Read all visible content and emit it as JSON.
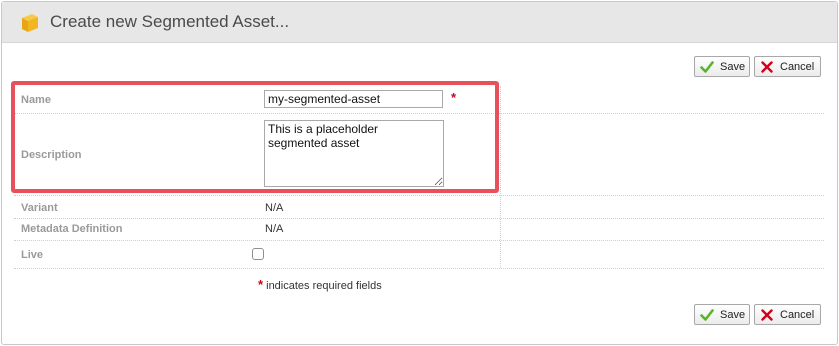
{
  "window": {
    "title": "Create new Segmented Asset...",
    "icon": "cube-icon"
  },
  "toolbar": {
    "save_label": "Save",
    "cancel_label": "Cancel"
  },
  "form": {
    "name": {
      "label": "Name",
      "value": "my-segmented-asset",
      "required": true
    },
    "description": {
      "label": "Description",
      "value": "This is a placeholder segmented asset"
    },
    "variant": {
      "label": "Variant",
      "value": "N/A"
    },
    "metadata_definition": {
      "label": "Metadata Definition",
      "value": "N/A"
    },
    "live": {
      "label": "Live",
      "checked": false
    }
  },
  "footer": {
    "required_marker": "*",
    "required_note": "indicates required fields"
  },
  "colors": {
    "highlight": "#e8505c",
    "required": "#d0021b",
    "save_check": "#5bb32a",
    "cancel_x": "#d0021b"
  }
}
